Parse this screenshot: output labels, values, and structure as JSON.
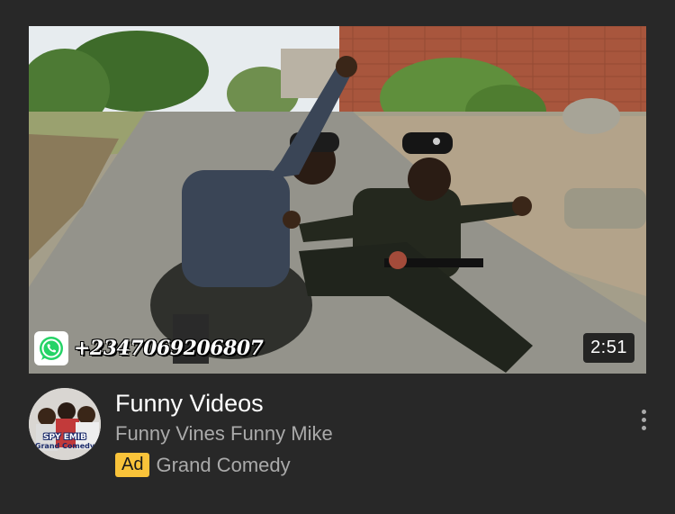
{
  "video": {
    "duration": "2:51",
    "thumbnail_overlay": {
      "icon": "whatsapp-icon",
      "phone_number": "+2347069206807"
    }
  },
  "meta": {
    "title": "Funny Videos",
    "channel": "Funny Vines Funny Mike",
    "ad_badge": "Ad",
    "advertiser": "Grand Comedy"
  },
  "avatar": {
    "text_line1": "SPY EMIB",
    "text_line2": "Grand Comedy"
  },
  "menu": {
    "icon": "more-vertical-icon"
  },
  "colors": {
    "background": "#282828",
    "title": "#ffffff",
    "secondary_text": "#aaaaaa",
    "ad_badge": "#f9c33a",
    "whatsapp": "#25d366"
  }
}
